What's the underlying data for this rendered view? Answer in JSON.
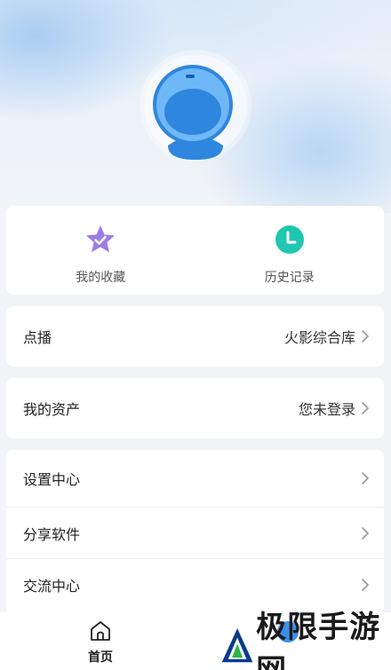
{
  "profile": {
    "avatar": "default-avatar-icon"
  },
  "quick_actions": [
    {
      "label": "我的收藏",
      "icon": "star-check-icon",
      "color": "#9b7de6"
    },
    {
      "label": "历史记录",
      "icon": "clock-icon",
      "color": "#1fc7b0"
    }
  ],
  "vod": {
    "label": "点播",
    "value": "火影综合库"
  },
  "assets": {
    "label": "我的资产",
    "value": "您未登录"
  },
  "menu": [
    {
      "label": "设置中心"
    },
    {
      "label": "分享软件"
    },
    {
      "label": "交流中心"
    }
  ],
  "tabbar": {
    "home_label": "首页"
  },
  "watermark": {
    "text": "极限手游网"
  },
  "colors": {
    "accent": "#3d8ee8",
    "background": "#f2f4f7"
  }
}
